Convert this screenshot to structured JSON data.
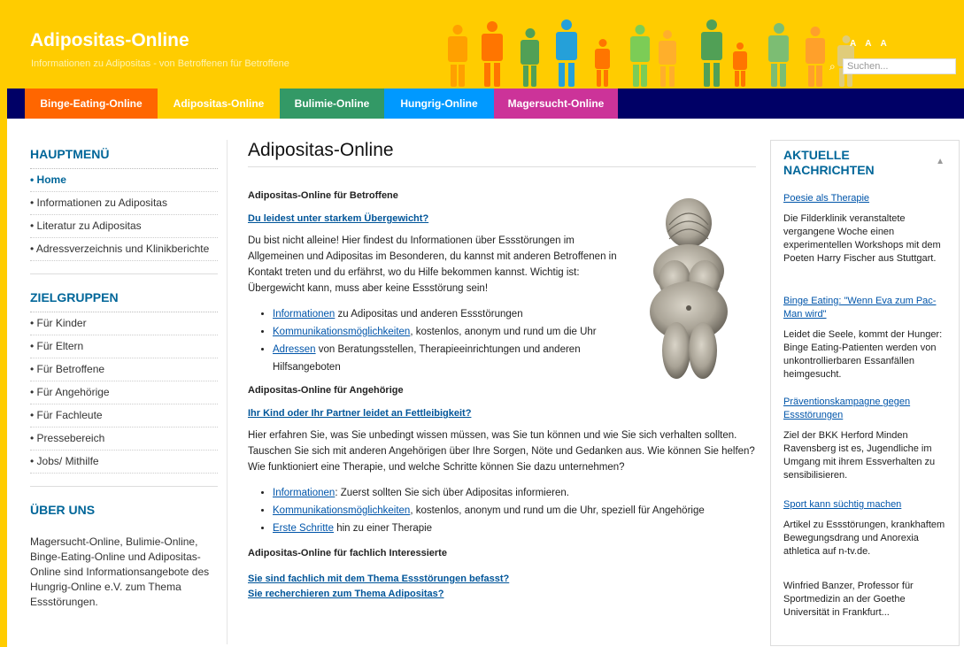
{
  "header": {
    "title": "Adipositas-Online",
    "tagline": "Informationen zu Adipositas - von Betroffenen für Betroffene",
    "font_size_controls": "A A A",
    "search_placeholder": "Suchen..."
  },
  "nav": {
    "tabs": [
      {
        "label": "Binge-Eating-Online",
        "color": "#ff6600"
      },
      {
        "label": "Adipositas-Online",
        "color": "#ffcc00"
      },
      {
        "label": "Bulimie-Online",
        "color": "#339966"
      },
      {
        "label": "Hungrig-Online",
        "color": "#0099ff"
      },
      {
        "label": "Magersucht-Online",
        "color": "#cc3399"
      }
    ]
  },
  "sidebar": {
    "hauptmenu_title": "HAUPTMENÜ",
    "hauptmenu": [
      "Home",
      "Informationen zu Adipositas",
      "Literatur zu Adipositas",
      "Adressverzeichnis und Klinikberichte"
    ],
    "zielgruppen_title": "ZIELGRUPPEN",
    "zielgruppen": [
      "Für Kinder",
      "Für Eltern",
      "Für Betroffene",
      "Für Angehörige",
      "Für Fachleute",
      "Pressebereich",
      "Jobs/ Mithilfe"
    ],
    "ueber_title": "ÜBER UNS",
    "ueber_text": "Magersucht-Online, Bulimie-Online, Binge-Eating-Online und Adipositas-Online sind Informationsangebote des Hungrig-Online e.V. zum Thema Essstörungen."
  },
  "main": {
    "title": "Adipositas-Online",
    "s1_heading": "Adipositas-Online für Betroffene",
    "s1_link": "Du leidest unter starkem Übergewicht?",
    "s1_text": "Du bist nicht alleine! Hier findest du Informationen über Essstörungen im Allgemeinen und Adipositas im Besonderen, du kannst mit anderen Betroffenen in Kontakt treten und du erfährst, wo du Hilfe bekommen kannst. Wichtig ist: Übergewicht kann, muss aber keine Essstörung sein!",
    "s1_items": [
      {
        "link": "Informationen",
        "rest": " zu Adipositas und anderen Essstörungen"
      },
      {
        "link": "Kommunikationsmöglichkeiten",
        "rest": ", kostenlos, anonym und rund um die Uhr"
      },
      {
        "link": "Adressen",
        "rest": " von Beratungsstellen, Therapieeinrichtungen und anderen Hilfsangeboten"
      }
    ],
    "s2_heading": "Adipositas-Online für Angehörige",
    "s2_link": "Ihr Kind oder Ihr Partner leidet an Fettleibigkeit?",
    "s2_text": "Hier erfahren Sie, was Sie unbedingt wissen müssen, was Sie tun können und wie Sie sich verhalten sollten. Tauschen Sie sich mit anderen Angehörigen über Ihre Sorgen, Nöte und Gedanken aus. Wie können Sie helfen? Wie funktioniert eine Therapie, und welche Schritte können Sie dazu unternehmen?",
    "s2_items": [
      {
        "link": "Informationen",
        "rest": ": Zuerst sollten Sie sich über Adipositas informieren."
      },
      {
        "link": "Kommunikationsmöglichkeiten",
        "rest": ", kostenlos, anonym und rund um die Uhr, speziell für Angehörige"
      },
      {
        "link": "Erste Schritte",
        "rest": " hin zu einer Therapie"
      }
    ],
    "s3_heading": "Adipositas-Online für fachlich Interessierte",
    "s3_link1": "Sie sind fachlich mit dem Thema Essstörungen befasst?",
    "s3_link2": "Sie recherchieren zum Thema Adipositas?"
  },
  "news": {
    "title": "AKTUELLE NACHRICHTEN",
    "items": [
      {
        "link": "Poesie als Therapie",
        "text": "Die Filderklinik veranstaltete vergangene Woche einen experimentellen Workshops mit dem Poeten Harry Fischer aus Stuttgart."
      },
      {
        "link": "Binge Eating: \"Wenn Eva zum Pac-Man wird\"",
        "text": "Leidet die Seele, kommt der Hunger: Binge Eating-Patienten werden von unkontrollierbaren Essanfällen heimgesucht."
      },
      {
        "link": "Präventionskampagne gegen Essstörungen",
        "text": "Ziel der BKK Herford Minden Ravensberg ist es, Jugendliche im Umgang mit ihrem Essverhalten zu sensibilisieren."
      },
      {
        "link": "Sport kann süchtig machen",
        "text": "Artikel zu Essstörungen, krankhaftem Bewegungsdrang und Anorexia athletica auf n-tv.de."
      }
    ],
    "extra_text": "Winfried Banzer, Professor für Sportmedizin an der Goethe Universität in Frankfurt..."
  }
}
